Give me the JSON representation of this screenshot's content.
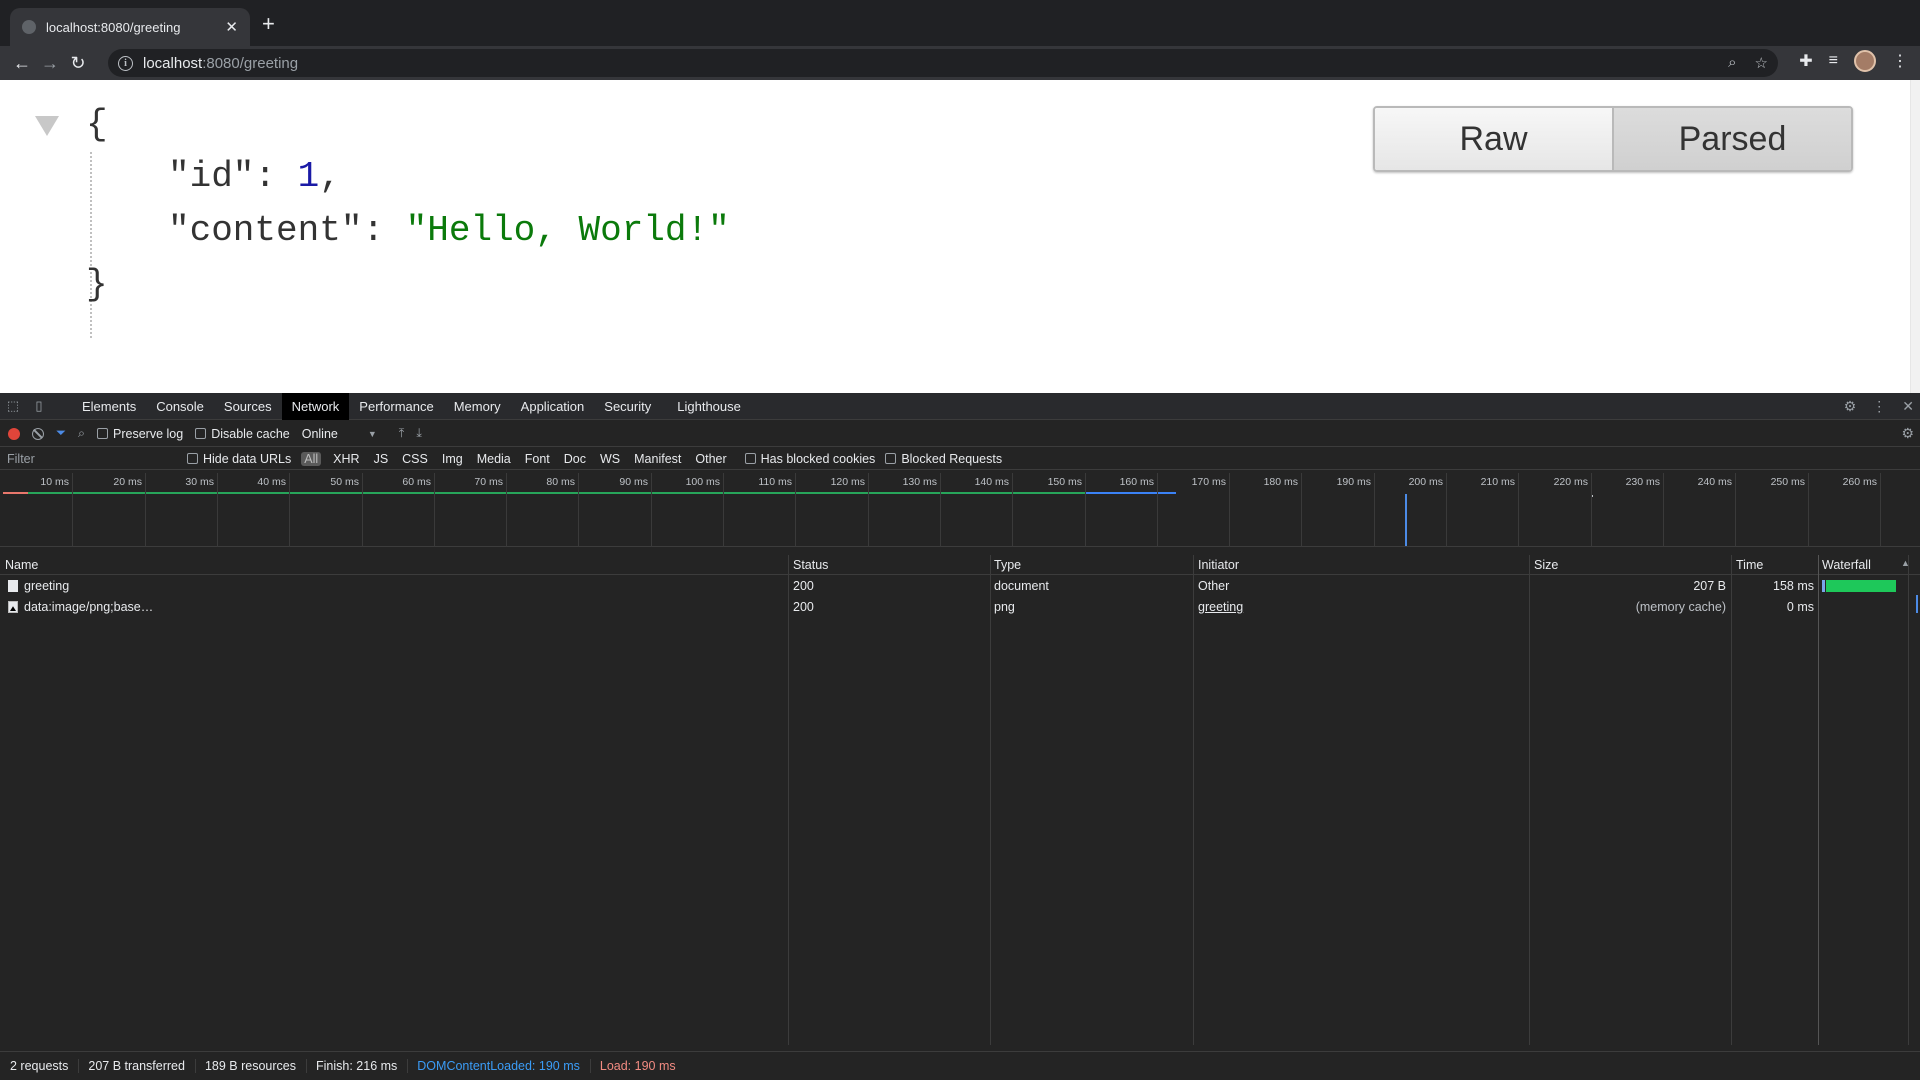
{
  "browser": {
    "tab_title": "localhost:8080/greeting",
    "url_host": "localhost",
    "url_rest": ":8080/greeting"
  },
  "json_view": {
    "open_brace": "{",
    "close_brace": "}",
    "lines": [
      {
        "key": "\"id\"",
        "sep": ": ",
        "value": "1",
        "tail": ","
      },
      {
        "key": "\"content\"",
        "sep": ": ",
        "value": "\"Hello, World!\"",
        "tail": ""
      }
    ],
    "raw_label": "Raw",
    "parsed_label": "Parsed"
  },
  "devtools": {
    "tabs": [
      "Elements",
      "Console",
      "Sources",
      "Network",
      "Performance",
      "Memory",
      "Application",
      "Security",
      "Lighthouse"
    ],
    "active_tab": "Network",
    "toolbar": {
      "preserve_log": "Preserve log",
      "disable_cache": "Disable cache",
      "throttle": "Online"
    },
    "filter": {
      "placeholder": "Filter",
      "hide_data_urls": "Hide data URLs",
      "types": [
        "All",
        "XHR",
        "JS",
        "CSS",
        "Img",
        "Media",
        "Font",
        "Doc",
        "WS",
        "Manifest",
        "Other"
      ],
      "has_blocked_cookies": "Has blocked cookies",
      "blocked_requests": "Blocked Requests"
    },
    "overview_ticks": [
      "10 ms",
      "20 ms",
      "30 ms",
      "40 ms",
      "50 ms",
      "60 ms",
      "70 ms",
      "80 ms",
      "90 ms",
      "100 ms",
      "110 ms",
      "120 ms",
      "130 ms",
      "140 ms",
      "150 ms",
      "160 ms",
      "170 ms",
      "180 ms",
      "190 ms",
      "200 ms",
      "210 ms",
      "220 ms",
      "230 ms",
      "240 ms",
      "250 ms",
      "260 ms"
    ],
    "table": {
      "headers": {
        "name": "Name",
        "status": "Status",
        "type": "Type",
        "initiator": "Initiator",
        "size": "Size",
        "time": "Time",
        "waterfall": "Waterfall"
      },
      "rows": [
        {
          "name": "greeting",
          "status": "200",
          "type": "document",
          "initiator": "Other",
          "size": "207 B",
          "time": "158 ms"
        },
        {
          "name": "data:image/png;base…",
          "status": "200",
          "type": "png",
          "initiator": "greeting",
          "size": "(memory cache)",
          "time": "0 ms"
        }
      ]
    },
    "status": {
      "requests": "2 requests",
      "transferred": "207 B transferred",
      "resources": "189 B resources",
      "finish": "Finish: 216 ms",
      "dcl": "DOMContentLoaded: 190 ms",
      "load": "Load: 190 ms"
    }
  }
}
